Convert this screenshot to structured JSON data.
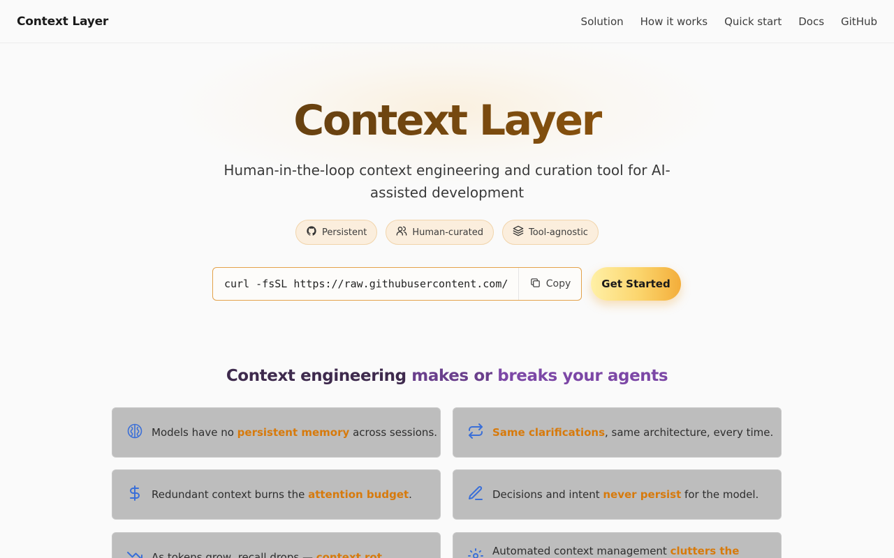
{
  "header": {
    "brand": "Context Layer",
    "nav": [
      "Solution",
      "How it works",
      "Quick start",
      "Docs",
      "GitHub"
    ]
  },
  "hero": {
    "title": "Context Layer",
    "subtitle": "Human-in-the-loop context engineering and curation tool for AI-assisted development",
    "pills": [
      {
        "label": "Persistent",
        "icon": "github-icon"
      },
      {
        "label": "Human-curated",
        "icon": "users-icon"
      },
      {
        "label": "Tool-agnostic",
        "icon": "layers-icon"
      }
    ],
    "command": "curl -fsSL https://raw.githubusercontent.com/",
    "copy_label": "Copy",
    "cta_label": "Get Started"
  },
  "section": {
    "title_part1": "Context engineering",
    "title_part2": "makes or",
    "title_part3": "breaks your agents"
  },
  "cards": [
    {
      "pre": "Models have no ",
      "hl": "persistent memory",
      "post": " across sessions.",
      "icon": "brain-icon"
    },
    {
      "pre": "",
      "hl": "Same clarifications",
      "post": ", same architecture, every time.",
      "icon": "repeat-icon"
    },
    {
      "pre": "Redundant context burns the ",
      "hl": "attention budget",
      "post": ".",
      "icon": "dollar-icon"
    },
    {
      "pre": "Decisions and intent ",
      "hl": "never persist",
      "post": " for the model.",
      "icon": "pen-icon"
    },
    {
      "pre": "As tokens grow, recall drops — ",
      "hl": "context rot",
      "post": ".",
      "icon": "trending-down-icon"
    },
    {
      "pre": "Automated context management ",
      "hl": "clutters the context",
      "post": ".",
      "icon": "settings-icon"
    }
  ],
  "colors": {
    "accent": "#d77a0c",
    "title_gradient_start": "#5a3a12",
    "title_gradient_end": "#a8620a",
    "pill_bg": "#fbeedd",
    "card_bg": "#bdbdbd",
    "icon_blue": "#3a6fd8",
    "section_purple": "#7c47a6"
  }
}
